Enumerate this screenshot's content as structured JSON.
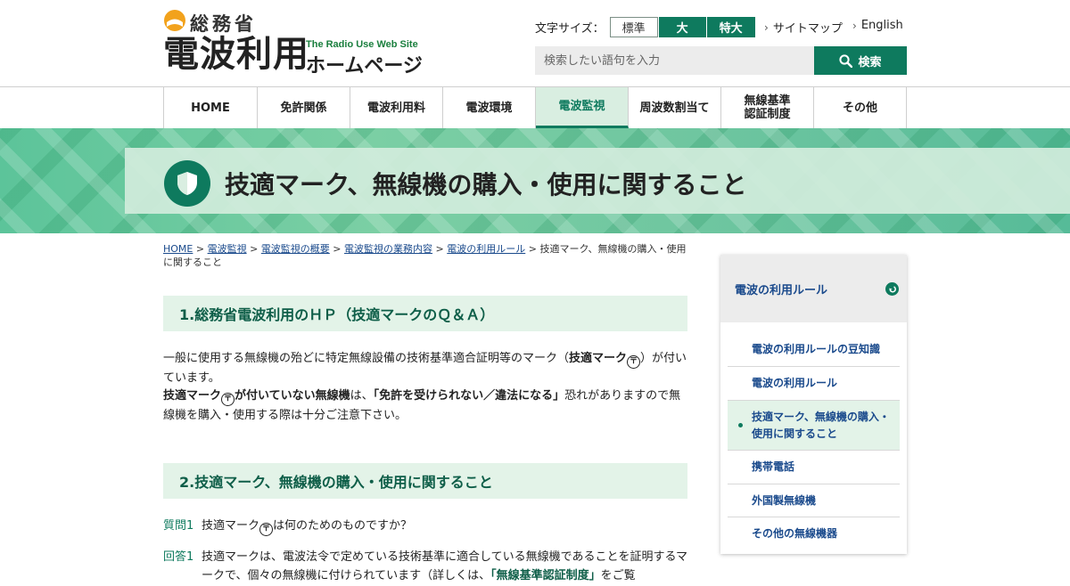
{
  "header": {
    "ministry": "総務省",
    "site_name": "電波利用",
    "site_sub": "The Radio Use Web Site",
    "site_hp": "ホームページ",
    "fontsize_label": "文字サイズ：",
    "fontsize_options": [
      "標準",
      "大",
      "特大"
    ],
    "sitemap": "サイトマップ",
    "english": "English",
    "search_placeholder": "検索したい語句を入力",
    "search_button": "検索"
  },
  "nav": [
    {
      "label": "HOME"
    },
    {
      "label": "免許関係"
    },
    {
      "label": "電波利用料"
    },
    {
      "label": "電波環境"
    },
    {
      "label": "電波監視"
    },
    {
      "label": "周波数割当て"
    },
    {
      "label": "無線基準認証制度"
    },
    {
      "label": "その他"
    }
  ],
  "hero": {
    "title": "技適マーク、無線機の購入・使用に関すること"
  },
  "breadcrumb": {
    "links": [
      "HOME",
      "電波監視",
      "電波監視の概要",
      "電波監視の業務内容",
      "電波の利用ルール"
    ],
    "separator": " > ",
    "current": "技適マーク、無線機の購入・使用に関すること"
  },
  "section1": {
    "heading": "1.総務省電波利用のＨＰ（技適マークのＱ＆Ａ）",
    "p1_a": "一般に使用する無線機の殆どに特定無線設備の技術基準適合証明等のマーク（",
    "p1_b": "技適マーク",
    "p1_c": "）が付いています。",
    "p2_a": "技適マーク",
    "p2_b": "が付いていない無線機",
    "p2_c": "は、",
    "p2_d": "「免許を受けられない／違法になる」",
    "p2_e": "恐れがありますので無線機を購入・使用する際は十分ご注意下さい。"
  },
  "section2": {
    "heading": "2.技適マーク、無線機の購入・使用に関すること",
    "q_label": "質問1",
    "q_text_a": "技適マーク",
    "q_text_b": "は何のためのものですか？",
    "a_label": "回答1",
    "a_text_a": "技適マークは、電波法令で定めている技術基準に適合している無線機であることを証明するマークで、個々の無線機に付けられています（詳しくは、",
    "a_link": "「無線基準認証制度」",
    "a_text_b": "をご覧"
  },
  "sidebar": {
    "heading": "電波の利用ルール",
    "items": [
      {
        "label": "電波の利用ルールの豆知識"
      },
      {
        "label": "電波の利用ルール"
      },
      {
        "label": "技適マーク、無線機の購入・使用に関すること"
      },
      {
        "label": "携帯電話"
      },
      {
        "label": "外国製無線機"
      },
      {
        "label": "その他の無線機器"
      }
    ]
  },
  "colors": {
    "brand_green": "#0e7a5e",
    "light_green": "#e3f3e8",
    "link_blue": "#1a4a8c"
  }
}
